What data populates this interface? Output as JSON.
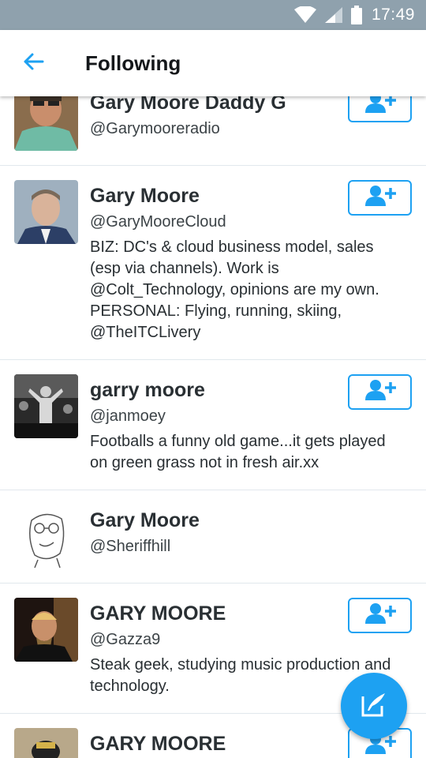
{
  "status_bar": {
    "time": "17:49",
    "icons": [
      "wifi-icon",
      "cell-signal-icon",
      "battery-icon"
    ]
  },
  "app_bar": {
    "title": "Following",
    "back_icon": "arrow-left-icon"
  },
  "accent_color": "#1da1f2",
  "users": [
    {
      "name": "Gary Moore Daddy G",
      "handle": "@Garymooreradio",
      "bio": [],
      "has_follow_button": true
    },
    {
      "name": "Gary Moore",
      "handle": "@GaryMooreCloud",
      "bio": [
        "BIZ: DC's & cloud business model, sales",
        "(esp via channels). Work is",
        "@Colt_Technology, opinions are my own.",
        "PERSONAL: Flying, running, skiing,",
        "@TheITCLivery"
      ],
      "has_follow_button": true
    },
    {
      "name": "garry moore",
      "handle": "@janmoey",
      "bio": [
        "Footballs a funny old game...it gets played",
        "on green grass not in fresh air.xx"
      ],
      "has_follow_button": true
    },
    {
      "name": "Gary Moore",
      "handle": "@Sheriffhill",
      "bio": [],
      "has_follow_button": false
    },
    {
      "name": "GARY MOORE",
      "handle": "@Gazza9",
      "bio": [
        "Steak geek, studying music production and",
        "technology."
      ],
      "has_follow_button": true
    },
    {
      "name": "GARY MOORE",
      "handle": "",
      "bio": [],
      "has_follow_button": true
    }
  ],
  "fab": {
    "icon": "compose-tweet-icon"
  }
}
